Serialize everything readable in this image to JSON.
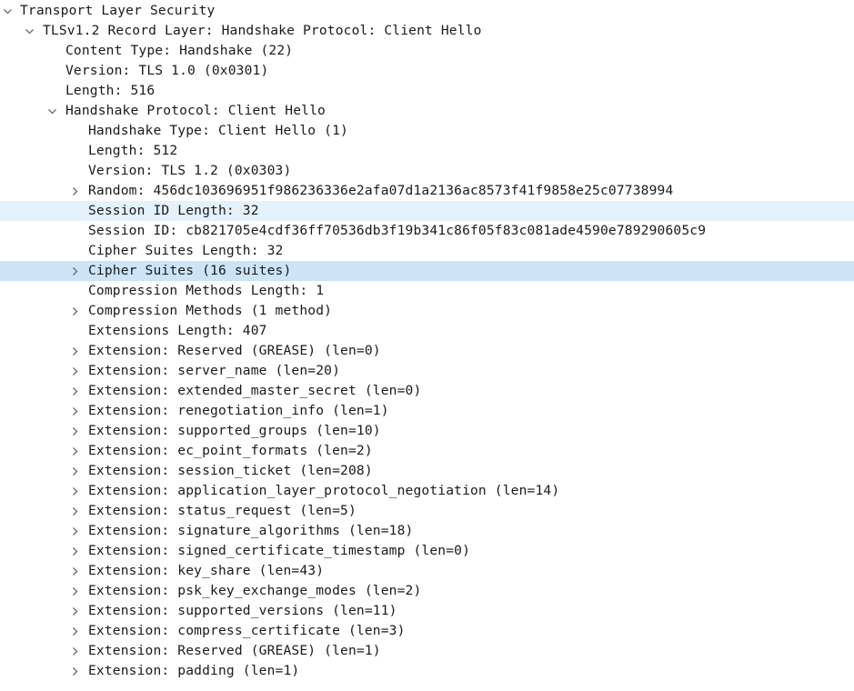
{
  "tree": [
    {
      "label": "Transport Layer Security",
      "depth": 0,
      "toggle": "expanded"
    },
    {
      "label": "TLSv1.2 Record Layer: Handshake Protocol: Client Hello",
      "depth": 1,
      "toggle": "expanded"
    },
    {
      "label": "Content Type: Handshake (22)",
      "depth": 2,
      "toggle": "none"
    },
    {
      "label": "Version: TLS 1.0 (0x0301)",
      "depth": 2,
      "toggle": "none"
    },
    {
      "label": "Length: 516",
      "depth": 2,
      "toggle": "none"
    },
    {
      "label": "Handshake Protocol: Client Hello",
      "depth": 2,
      "toggle": "expanded"
    },
    {
      "label": "Handshake Type: Client Hello (1)",
      "depth": 3,
      "toggle": "none"
    },
    {
      "label": "Length: 512",
      "depth": 3,
      "toggle": "none"
    },
    {
      "label": "Version: TLS 1.2 (0x0303)",
      "depth": 3,
      "toggle": "none"
    },
    {
      "label": "Random: 456dc103696951f986236336e2afa07d1a2136ac8573f41f9858e25c07738994",
      "depth": 3,
      "toggle": "collapsed"
    },
    {
      "label": "Session ID Length: 32",
      "depth": 3,
      "toggle": "none",
      "highlight": "hover"
    },
    {
      "label": "Session ID: cb821705e4cdf36ff70536db3f19b341c86f05f83c081ade4590e789290605c9",
      "depth": 3,
      "toggle": "none"
    },
    {
      "label": "Cipher Suites Length: 32",
      "depth": 3,
      "toggle": "none"
    },
    {
      "label": "Cipher Suites (16 suites)",
      "depth": 3,
      "toggle": "collapsed",
      "highlight": "selected"
    },
    {
      "label": "Compression Methods Length: 1",
      "depth": 3,
      "toggle": "none"
    },
    {
      "label": "Compression Methods (1 method)",
      "depth": 3,
      "toggle": "collapsed"
    },
    {
      "label": "Extensions Length: 407",
      "depth": 3,
      "toggle": "none"
    },
    {
      "label": "Extension: Reserved (GREASE) (len=0)",
      "depth": 3,
      "toggle": "collapsed"
    },
    {
      "label": "Extension: server_name (len=20)",
      "depth": 3,
      "toggle": "collapsed"
    },
    {
      "label": "Extension: extended_master_secret (len=0)",
      "depth": 3,
      "toggle": "collapsed"
    },
    {
      "label": "Extension: renegotiation_info (len=1)",
      "depth": 3,
      "toggle": "collapsed"
    },
    {
      "label": "Extension: supported_groups (len=10)",
      "depth": 3,
      "toggle": "collapsed"
    },
    {
      "label": "Extension: ec_point_formats (len=2)",
      "depth": 3,
      "toggle": "collapsed"
    },
    {
      "label": "Extension: session_ticket (len=208)",
      "depth": 3,
      "toggle": "collapsed"
    },
    {
      "label": "Extension: application_layer_protocol_negotiation (len=14)",
      "depth": 3,
      "toggle": "collapsed"
    },
    {
      "label": "Extension: status_request (len=5)",
      "depth": 3,
      "toggle": "collapsed"
    },
    {
      "label": "Extension: signature_algorithms (len=18)",
      "depth": 3,
      "toggle": "collapsed"
    },
    {
      "label": "Extension: signed_certificate_timestamp (len=0)",
      "depth": 3,
      "toggle": "collapsed"
    },
    {
      "label": "Extension: key_share (len=43)",
      "depth": 3,
      "toggle": "collapsed"
    },
    {
      "label": "Extension: psk_key_exchange_modes (len=2)",
      "depth": 3,
      "toggle": "collapsed"
    },
    {
      "label": "Extension: supported_versions (len=11)",
      "depth": 3,
      "toggle": "collapsed"
    },
    {
      "label": "Extension: compress_certificate (len=3)",
      "depth": 3,
      "toggle": "collapsed"
    },
    {
      "label": "Extension: Reserved (GREASE) (len=1)",
      "depth": 3,
      "toggle": "collapsed"
    },
    {
      "label": "Extension: padding (len=1)",
      "depth": 3,
      "toggle": "collapsed"
    }
  ],
  "colors": {
    "background": "#ffffff",
    "text": "#1a1a1a",
    "chevron": "#6b6b6b",
    "hover_row": "#e5f1fb",
    "selected_row": "#cce4f7"
  }
}
